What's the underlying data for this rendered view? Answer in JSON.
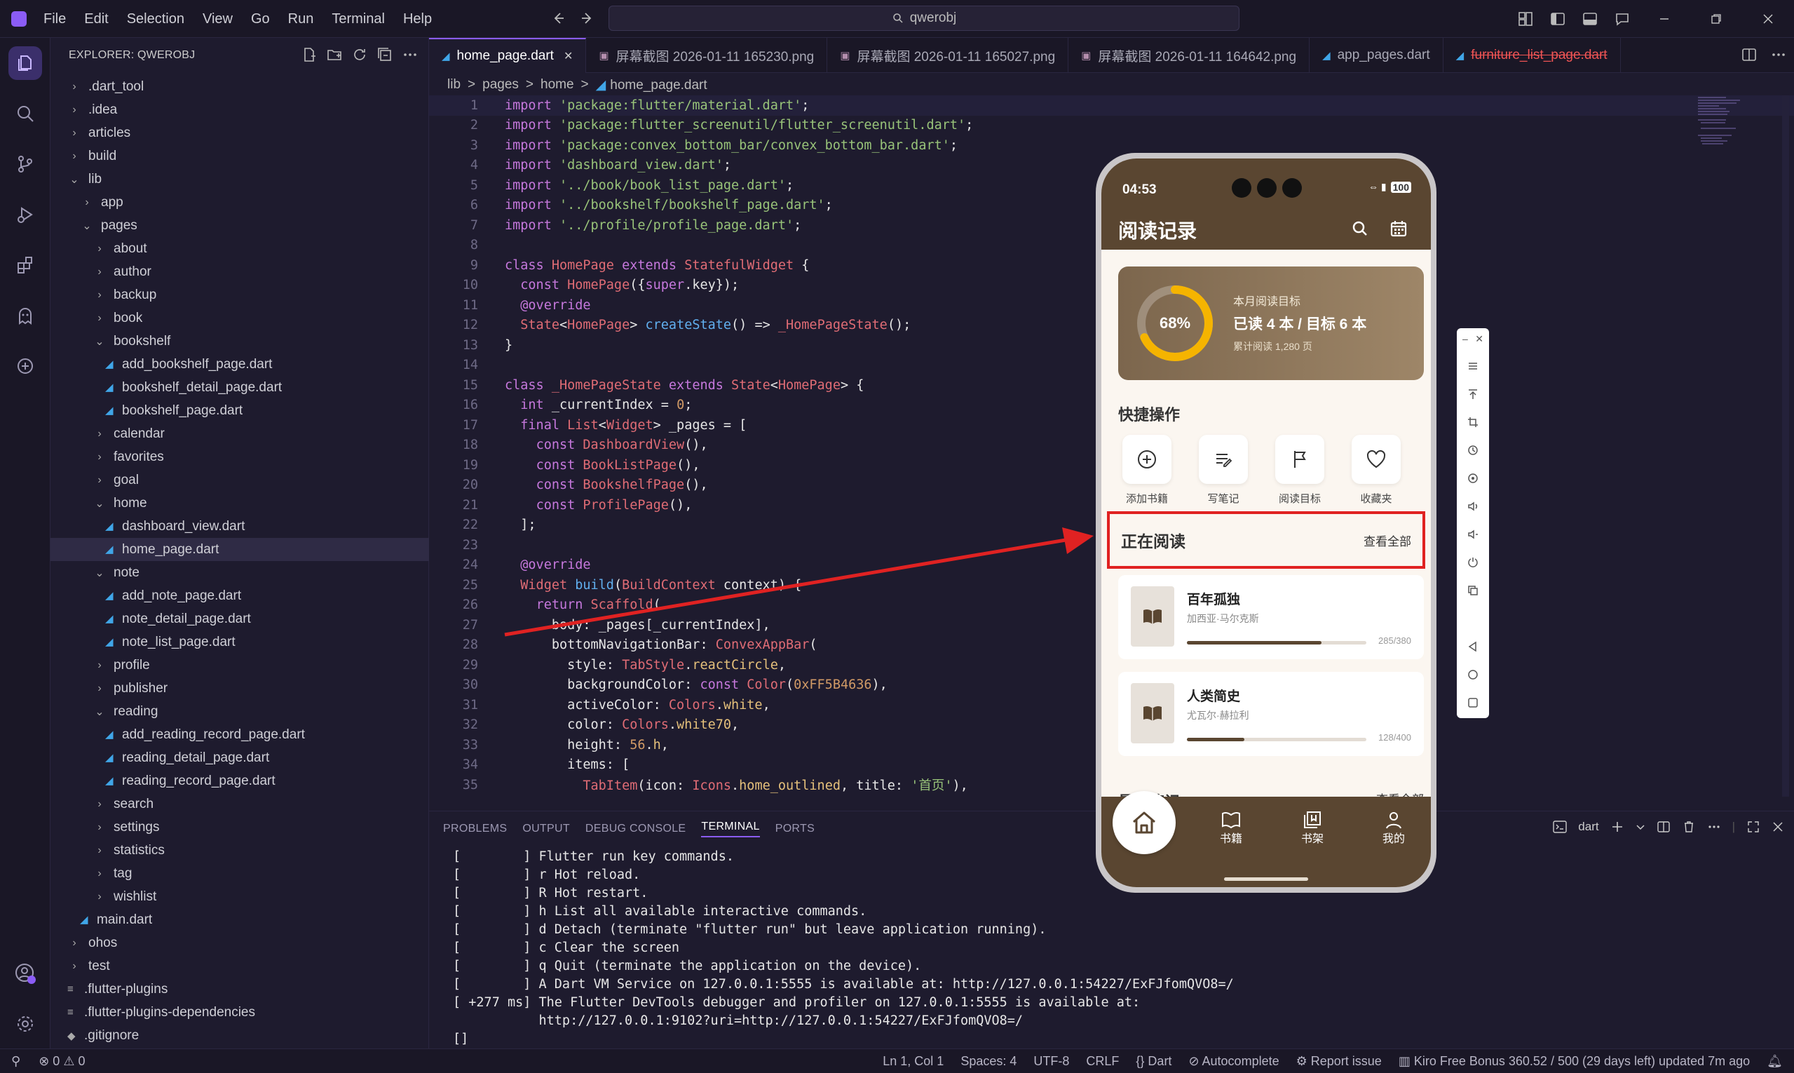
{
  "menu": [
    "File",
    "Edit",
    "Selection",
    "View",
    "Go",
    "Run",
    "Terminal",
    "Help"
  ],
  "search": {
    "label": "qwerobj"
  },
  "explorer": {
    "title": "EXPLORER: QWEROBJ",
    "tree": [
      {
        "label": ".dart_tool",
        "type": "folder",
        "depth": 1,
        "open": false
      },
      {
        "label": ".idea",
        "type": "folder",
        "depth": 1,
        "open": false
      },
      {
        "label": "articles",
        "type": "folder",
        "depth": 1,
        "open": false
      },
      {
        "label": "build",
        "type": "folder",
        "depth": 1,
        "open": false
      },
      {
        "label": "lib",
        "type": "folder",
        "depth": 1,
        "open": true
      },
      {
        "label": "app",
        "type": "folder",
        "depth": 2,
        "open": false
      },
      {
        "label": "pages",
        "type": "folder",
        "depth": 2,
        "open": true
      },
      {
        "label": "about",
        "type": "folder",
        "depth": 3,
        "open": false
      },
      {
        "label": "author",
        "type": "folder",
        "depth": 3,
        "open": false
      },
      {
        "label": "backup",
        "type": "folder",
        "depth": 3,
        "open": false
      },
      {
        "label": "book",
        "type": "folder",
        "depth": 3,
        "open": false
      },
      {
        "label": "bookshelf",
        "type": "folder",
        "depth": 3,
        "open": true
      },
      {
        "label": "add_bookshelf_page.dart",
        "type": "dart",
        "depth": 4
      },
      {
        "label": "bookshelf_detail_page.dart",
        "type": "dart",
        "depth": 4
      },
      {
        "label": "bookshelf_page.dart",
        "type": "dart",
        "depth": 4
      },
      {
        "label": "calendar",
        "type": "folder",
        "depth": 3,
        "open": false
      },
      {
        "label": "favorites",
        "type": "folder",
        "depth": 3,
        "open": false
      },
      {
        "label": "goal",
        "type": "folder",
        "depth": 3,
        "open": false
      },
      {
        "label": "home",
        "type": "folder",
        "depth": 3,
        "open": true
      },
      {
        "label": "dashboard_view.dart",
        "type": "dart",
        "depth": 4
      },
      {
        "label": "home_page.dart",
        "type": "dart",
        "depth": 4,
        "selected": true
      },
      {
        "label": "note",
        "type": "folder",
        "depth": 3,
        "open": true
      },
      {
        "label": "add_note_page.dart",
        "type": "dart",
        "depth": 4
      },
      {
        "label": "note_detail_page.dart",
        "type": "dart",
        "depth": 4
      },
      {
        "label": "note_list_page.dart",
        "type": "dart",
        "depth": 4
      },
      {
        "label": "profile",
        "type": "folder",
        "depth": 3,
        "open": false
      },
      {
        "label": "publisher",
        "type": "folder",
        "depth": 3,
        "open": false
      },
      {
        "label": "reading",
        "type": "folder",
        "depth": 3,
        "open": true
      },
      {
        "label": "add_reading_record_page.dart",
        "type": "dart",
        "depth": 4
      },
      {
        "label": "reading_detail_page.dart",
        "type": "dart",
        "depth": 4
      },
      {
        "label": "reading_record_page.dart",
        "type": "dart",
        "depth": 4
      },
      {
        "label": "search",
        "type": "folder",
        "depth": 3,
        "open": false
      },
      {
        "label": "settings",
        "type": "folder",
        "depth": 3,
        "open": false
      },
      {
        "label": "statistics",
        "type": "folder",
        "depth": 3,
        "open": false
      },
      {
        "label": "tag",
        "type": "folder",
        "depth": 3,
        "open": false
      },
      {
        "label": "wishlist",
        "type": "folder",
        "depth": 3,
        "open": false
      },
      {
        "label": "main.dart",
        "type": "dart",
        "depth": 2
      },
      {
        "label": "ohos",
        "type": "folder",
        "depth": 1,
        "open": false
      },
      {
        "label": "test",
        "type": "folder",
        "depth": 1,
        "open": false
      },
      {
        "label": ".flutter-plugins",
        "type": "file",
        "depth": 1
      },
      {
        "label": ".flutter-plugins-dependencies",
        "type": "file",
        "depth": 1
      },
      {
        "label": ".gitignore",
        "type": "git",
        "depth": 1
      }
    ]
  },
  "tabs": [
    {
      "label": "home_page.dart",
      "icon": "dart",
      "active": true,
      "close": "✕"
    },
    {
      "label": "屏幕截图 2026-01-11 165230.png",
      "icon": "image"
    },
    {
      "label": "屏幕截图 2026-01-11 165027.png",
      "icon": "image"
    },
    {
      "label": "屏幕截图 2026-01-11 164642.png",
      "icon": "image"
    },
    {
      "label": "app_pages.dart",
      "icon": "dart"
    },
    {
      "label": "furniture_list_page.dart",
      "icon": "dart",
      "error": true
    }
  ],
  "breadcrumb": [
    "lib",
    ">",
    "pages",
    ">",
    "home",
    ">",
    "home_page.dart"
  ],
  "code": [
    [
      [
        "k",
        "import "
      ],
      [
        "s",
        "'package:flutter/material.dart'"
      ],
      [
        "w",
        ";"
      ]
    ],
    [
      [
        "k",
        "import "
      ],
      [
        "s",
        "'package:flutter_screenutil/flutter_screenutil.dart'"
      ],
      [
        "w",
        ";"
      ]
    ],
    [
      [
        "k",
        "import "
      ],
      [
        "s",
        "'package:convex_bottom_bar/convex_bottom_bar.dart'"
      ],
      [
        "w",
        ";"
      ]
    ],
    [
      [
        "k",
        "import "
      ],
      [
        "s",
        "'dashboard_view.dart'"
      ],
      [
        "w",
        ";"
      ]
    ],
    [
      [
        "k",
        "import "
      ],
      [
        "s",
        "'../book/book_list_page.dart'"
      ],
      [
        "w",
        ";"
      ]
    ],
    [
      [
        "k",
        "import "
      ],
      [
        "s",
        "'../bookshelf/bookshelf_page.dart'"
      ],
      [
        "w",
        ";"
      ]
    ],
    [
      [
        "k",
        "import "
      ],
      [
        "s",
        "'../profile/profile_page.dart'"
      ],
      [
        "w",
        ";"
      ]
    ],
    [],
    [
      [
        "k",
        "class "
      ],
      [
        "t",
        "HomePage "
      ],
      [
        "k",
        "extends "
      ],
      [
        "t",
        "StatefulWidget "
      ],
      [
        "w",
        "{"
      ]
    ],
    [
      [
        "w",
        "  "
      ],
      [
        "k",
        "const "
      ],
      [
        "t",
        "HomePage"
      ],
      [
        "w",
        "({"
      ],
      [
        "k",
        "super"
      ],
      [
        "w",
        ".key});"
      ]
    ],
    [
      [
        "w",
        "  "
      ],
      [
        "k",
        "@override"
      ]
    ],
    [
      [
        "w",
        "  "
      ],
      [
        "t",
        "State"
      ],
      [
        "w",
        "<"
      ],
      [
        "t",
        "HomePage"
      ],
      [
        "w",
        "> "
      ],
      [
        "f",
        "createState"
      ],
      [
        "w",
        "() => "
      ],
      [
        "t",
        "_HomePageState"
      ],
      [
        "w",
        "();"
      ]
    ],
    [
      [
        "w",
        "}"
      ]
    ],
    [],
    [
      [
        "k",
        "class "
      ],
      [
        "t",
        "_HomePageState "
      ],
      [
        "k",
        "extends "
      ],
      [
        "t",
        "State"
      ],
      [
        "w",
        "<"
      ],
      [
        "t",
        "HomePage"
      ],
      [
        "w",
        "> {"
      ]
    ],
    [
      [
        "w",
        "  "
      ],
      [
        "k",
        "int "
      ],
      [
        "w",
        "_currentIndex = "
      ],
      [
        "n",
        "0"
      ],
      [
        "w",
        ";"
      ]
    ],
    [
      [
        "w",
        "  "
      ],
      [
        "k",
        "final "
      ],
      [
        "t",
        "List"
      ],
      [
        "w",
        "<"
      ],
      [
        "t",
        "Widget"
      ],
      [
        "w",
        "> _pages = ["
      ]
    ],
    [
      [
        "w",
        "    "
      ],
      [
        "k",
        "const "
      ],
      [
        "t",
        "DashboardView"
      ],
      [
        "w",
        "(),"
      ]
    ],
    [
      [
        "w",
        "    "
      ],
      [
        "k",
        "const "
      ],
      [
        "t",
        "BookListPage"
      ],
      [
        "w",
        "(),"
      ]
    ],
    [
      [
        "w",
        "    "
      ],
      [
        "k",
        "const "
      ],
      [
        "t",
        "BookshelfPage"
      ],
      [
        "w",
        "(),"
      ]
    ],
    [
      [
        "w",
        "    "
      ],
      [
        "k",
        "const "
      ],
      [
        "t",
        "ProfilePage"
      ],
      [
        "w",
        "(),"
      ]
    ],
    [
      [
        "w",
        "  ];"
      ]
    ],
    [],
    [
      [
        "w",
        "  "
      ],
      [
        "k",
        "@override"
      ]
    ],
    [
      [
        "w",
        "  "
      ],
      [
        "t",
        "Widget "
      ],
      [
        "f",
        "build"
      ],
      [
        "w",
        "("
      ],
      [
        "t",
        "BuildContext "
      ],
      [
        "w",
        "context) {"
      ]
    ],
    [
      [
        "w",
        "    "
      ],
      [
        "k",
        "return "
      ],
      [
        "t",
        "Scaffold"
      ],
      [
        "w",
        "("
      ]
    ],
    [
      [
        "w",
        "      body: _pages[_currentIndex],"
      ]
    ],
    [
      [
        "w",
        "      bottomNavigationBar: "
      ],
      [
        "t",
        "ConvexAppBar"
      ],
      [
        "w",
        "("
      ]
    ],
    [
      [
        "w",
        "        style: "
      ],
      [
        "t",
        "TabStyle"
      ],
      [
        "w",
        "."
      ],
      [
        "a",
        "reactCircle"
      ],
      [
        "w",
        ","
      ]
    ],
    [
      [
        "w",
        "        backgroundColor: "
      ],
      [
        "k",
        "const "
      ],
      [
        "t",
        "Color"
      ],
      [
        "w",
        "("
      ],
      [
        "n",
        "0xFF5B4636"
      ],
      [
        "w",
        "),"
      ]
    ],
    [
      [
        "w",
        "        activeColor: "
      ],
      [
        "t",
        "Colors"
      ],
      [
        "w",
        "."
      ],
      [
        "a",
        "white"
      ],
      [
        "w",
        ","
      ]
    ],
    [
      [
        "w",
        "        color: "
      ],
      [
        "t",
        "Colors"
      ],
      [
        "w",
        "."
      ],
      [
        "a",
        "white70"
      ],
      [
        "w",
        ","
      ]
    ],
    [
      [
        "w",
        "        height: "
      ],
      [
        "n",
        "56"
      ],
      [
        "w",
        "."
      ],
      [
        "a",
        "h"
      ],
      [
        "w",
        ","
      ]
    ],
    [
      [
        "w",
        "        items: ["
      ]
    ],
    [
      [
        "w",
        "          "
      ],
      [
        "t",
        "TabItem"
      ],
      [
        "w",
        "(icon: "
      ],
      [
        "t",
        "Icons"
      ],
      [
        "w",
        "."
      ],
      [
        "a",
        "home_outlined"
      ],
      [
        "w",
        ", title: "
      ],
      [
        "s",
        "'首页'"
      ],
      [
        "w",
        "),"
      ]
    ]
  ],
  "panel": {
    "tabs": [
      "PROBLEMS",
      "OUTPUT",
      "DEBUG CONSOLE",
      "TERMINAL",
      "PORTS"
    ],
    "active": "TERMINAL",
    "shell": "dart"
  },
  "terminal": [
    "[        ] Flutter run key commands.",
    "[        ] r Hot reload.",
    "[        ] R Hot restart.",
    "[        ] h List all available interactive commands.",
    "[        ] d Detach (terminate \"flutter run\" but leave application running).",
    "[        ] c Clear the screen",
    "[        ] q Quit (terminate the application on the device).",
    "[        ] A Dart VM Service on 127.0.0.1:5555 is available at: http://127.0.0.1:54227/ExFJfomQVO8=/",
    "[ +277 ms] The Flutter DevTools debugger and profiler on 127.0.0.1:5555 is available at:",
    "           http://127.0.0.1:9102?uri=http://127.0.0.1:54227/ExFJfomQVO8=/",
    "[]"
  ],
  "status": {
    "errors": "0",
    "warnings": "0",
    "items": [
      "Ln 1, Col 1",
      "Spaces: 4",
      "UTF-8",
      "CRLF",
      "{} Dart",
      "Autocomplete",
      "Report issue",
      "Kiro Free Bonus 360.52 / 500 (29 days left) updated 7m ago"
    ]
  },
  "phone": {
    "time": "04:53",
    "battery": "100",
    "title": "阅读记录",
    "goal": {
      "label": "本月阅读目标",
      "main": "已读 4 本 / 目标 6 本",
      "sub": "累计阅读 1,280 页",
      "percent_label": "68%",
      "percent": 0.68
    },
    "quick_title": "快捷操作",
    "quick": [
      {
        "label": "添加书籍",
        "icon": "add-circle-icon"
      },
      {
        "label": "写笔记",
        "icon": "note-edit-icon"
      },
      {
        "label": "阅读目标",
        "icon": "flag-icon"
      },
      {
        "label": "收藏夹",
        "icon": "heart-icon"
      }
    ],
    "reading_title": "正在阅读",
    "view_all": "查看全部",
    "books": [
      {
        "title": "百年孤独",
        "author": "加西亚·马尔克斯",
        "progress": "285/380",
        "fraction": 0.75
      },
      {
        "title": "人类简史",
        "author": "尤瓦尔·赫拉利",
        "progress": "128/400",
        "fraction": 0.32
      }
    ],
    "notes_title": "最新笔记",
    "notes_view_all": "查看全部",
    "nav": [
      "书籍",
      "书架",
      "我的"
    ]
  },
  "colors": {
    "accent": "#8b5cf6",
    "brand_brown": "#5B4636",
    "highlight": "#e02222",
    "ring": "#f5b400"
  }
}
